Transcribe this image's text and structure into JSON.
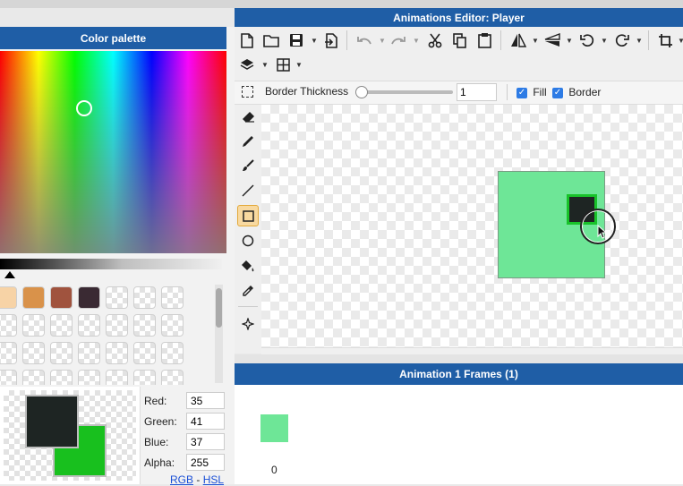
{
  "window": {
    "title": "Animations Editor: Player"
  },
  "palette": {
    "title": "Color palette",
    "swatches": [
      "#f7d3a6",
      "#d9924a",
      "#a0533e",
      "#3a2a33"
    ],
    "primary_color": "#1e2523",
    "secondary_color": "#18c01e",
    "red_label": "Red:",
    "red_value": "35",
    "green_label": "Green:",
    "green_value": "41",
    "blue_label": "Blue:",
    "blue_value": "37",
    "alpha_label": "Alpha:",
    "alpha_value": "255",
    "mode_rgb": "RGB",
    "mode_sep": "-",
    "mode_hsl": "HSL"
  },
  "toolbar": {
    "icons": [
      "new-file-icon",
      "open-folder-icon",
      "save-icon",
      "export-icon",
      "undo-icon",
      "redo-icon",
      "cut-icon",
      "copy-icon",
      "paste-icon",
      "flip-horizontal-icon",
      "flip-vertical-icon",
      "rotate-left-icon",
      "rotate-right-icon",
      "crop-icon",
      "layers-icon",
      "grid-icon"
    ]
  },
  "options": {
    "border_thickness_label": "Border Thickness",
    "border_thickness_value": "1",
    "slider_value": 0,
    "fill_label": "Fill",
    "border_label": "Border",
    "fill_checked": true,
    "border_checked": true
  },
  "tools": [
    "eraser-icon",
    "pencil-icon",
    "brush-icon",
    "line-icon",
    "rectangle-icon",
    "ellipse-icon",
    "fill-bucket-icon",
    "eyedropper-icon",
    "move-icon"
  ],
  "canvas": {
    "shape_fill": "#6ee697",
    "inner_fill": "#1e2523",
    "inner_border": "#19c22a"
  },
  "frames": {
    "title": "Animation 1 Frames (1)",
    "items": [
      {
        "index": "0",
        "color": "#6ee697"
      }
    ]
  }
}
